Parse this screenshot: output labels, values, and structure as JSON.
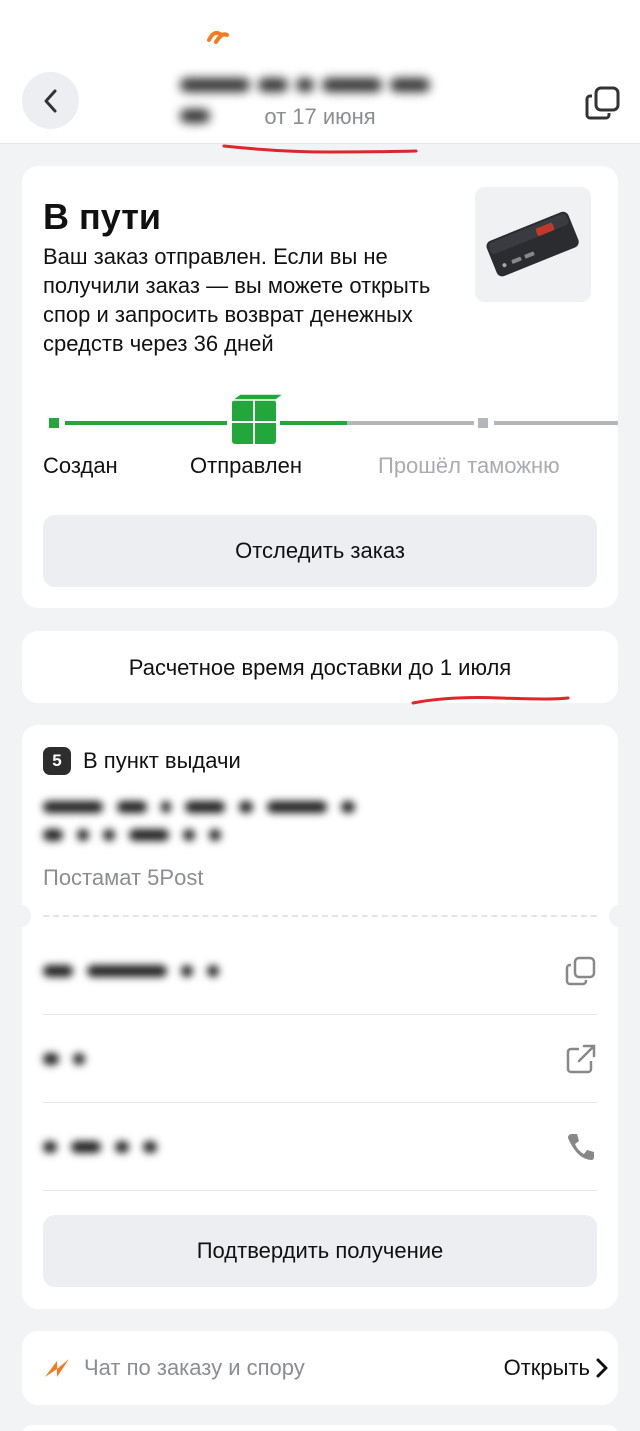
{
  "header": {
    "title_obscured": "",
    "subtitle": "от 17 июня"
  },
  "order_status": {
    "title": "В пути",
    "description": "Ваш заказ отправлен. Если вы не получили заказ — вы можете открыть спор и запросить возврат денежных средств через 36 дней",
    "stages": [
      {
        "label": "Создан",
        "state": "done"
      },
      {
        "label": "Отправлен",
        "state": "current"
      },
      {
        "label": "Прошёл таможню",
        "state": "pending"
      }
    ],
    "track_button": "Отследить заказ"
  },
  "delivery_estimate": {
    "text": "Расчетное время доставки до 1 июля"
  },
  "pickup": {
    "logo_text": "5",
    "title": "В пункт выдачи",
    "type": "Постамат 5Post",
    "confirm_button": "Подтвердить получение"
  },
  "chat": {
    "label": "Чат по заказу и спору",
    "action": "Открыть"
  },
  "colors": {
    "accent_green": "#22a83a",
    "annotation_red": "#e0262b",
    "brand_orange": "#f47a20"
  },
  "icons": [
    "chevron-left-icon",
    "copy-icon",
    "box-icon",
    "external-link-icon",
    "phone-icon",
    "lightning-icon",
    "chevron-right-icon"
  ]
}
